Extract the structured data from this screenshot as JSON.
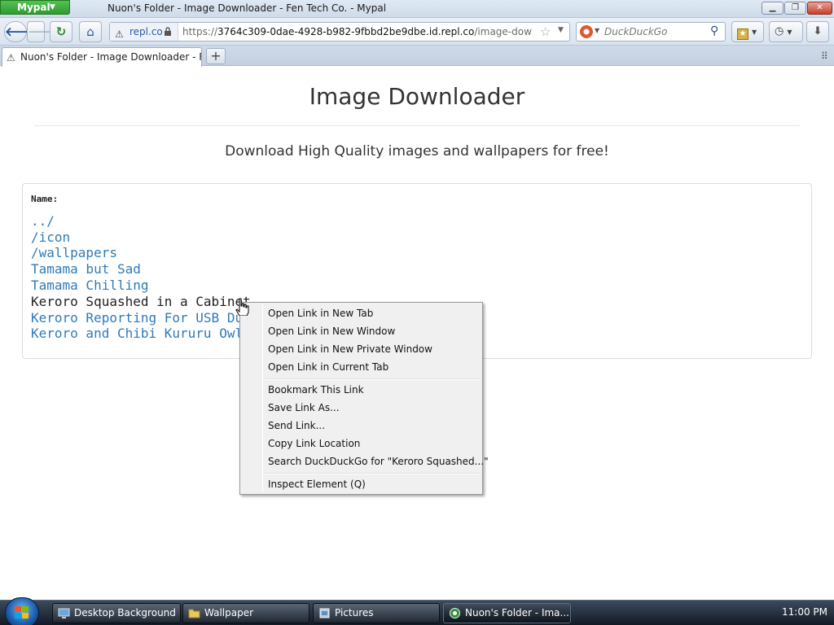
{
  "browser": {
    "app_button": "Mypal",
    "window_title": "Nuon's Folder - Image Downloader - Fen Tech Co. - Mypal",
    "url_site": "repl.co",
    "url_prefix": "https://",
    "url_host": "3764c309-0dae-4928-b982-9fbbd2be9dbe.id.repl.co",
    "url_path": "/image-downloader/nu",
    "search_placeholder": "DuckDuckGo",
    "tab_title": "Nuon's Folder - Image Downloader - Fe..."
  },
  "page": {
    "heading": "Image Downloader",
    "subtitle": "Download High Quality images and wallpapers for free!",
    "listing_label": "Name:",
    "entries": [
      "../",
      "/icon",
      "/wallpapers",
      "Tamama but Sad",
      "Tamama Chilling",
      "Keroro Squashed in a Cabinet",
      "Keroro Reporting For USB Duty",
      "Keroro and Chibi Kururu Owl"
    ]
  },
  "context_menu": {
    "items": [
      "Open Link in New Tab",
      "Open Link in New Window",
      "Open Link in New Private Window",
      "Open Link in Current Tab",
      "Bookmark This Link",
      "Save Link As...",
      "Send Link...",
      "Copy Link Location",
      "Search DuckDuckGo for \"Keroro Squashed...\"",
      "Inspect Element (Q)"
    ]
  },
  "taskbar": {
    "tasks": [
      "Desktop Background",
      "Wallpaper",
      "Pictures",
      "Nuon's Folder - Ima..."
    ],
    "clock": "11:00 PM"
  }
}
